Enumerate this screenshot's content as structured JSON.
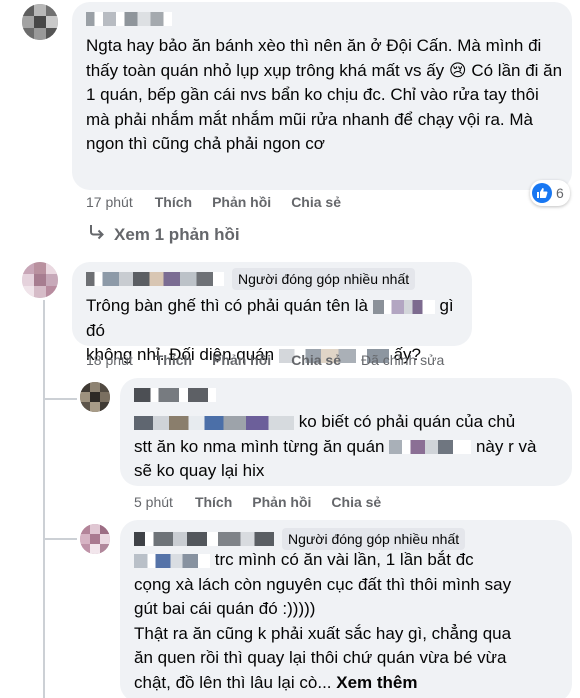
{
  "comments": [
    {
      "text": "Ngta hay bảo ăn bánh xèo thì nên ăn ở Đội Cấn. Mà mình đi thấy toàn quán nhỏ lụp xụp trông khá mất vs ấy 😢 Có lần đi ăn 1 quán, bếp gần cái nvs bẩn ko chịu đc. Chỉ vào rửa tay thôi mà phải nhắm mắt nhắm mũi rửa nhanh để chạy vội ra. Mà ngon thì cũng chả phải ngon cơ",
      "time": "17 phút",
      "like_label": "Thích",
      "reply_label": "Phản hồi",
      "share_label": "Chia sẻ",
      "reaction_count": "6",
      "reaction_icon": "like-icon",
      "view_replies_label": "Xem 1 phản hồi"
    },
    {
      "badge": "Người đóng góp nhiều nhất",
      "text_part1": "Trông bàn ghế thì có phải quán tên là",
      "text_part2": "gì đó",
      "text_part3": "không nhỉ. Đối diện quán",
      "text_part4": "ấy?",
      "time": "18 phút",
      "like_label": "Thích",
      "reply_label": "Phản hồi",
      "share_label": "Chia sẻ",
      "edited_label": "Đã chỉnh sửa"
    }
  ],
  "replies": [
    {
      "text_part1": "ko biết có phải quán của chủ",
      "text_part2": "stt ăn ko nma mình từng ăn quán",
      "text_part3": "này r và",
      "text_part4": "sẽ ko quay lại hix",
      "time": "5 phút",
      "like_label": "Thích",
      "reply_label": "Phản hồi",
      "share_label": "Chia sẻ"
    },
    {
      "badge": "Người đóng góp nhiều nhất",
      "text_part1": "trc mình có ăn vài lần, 1 lần bắt đc",
      "text_part2": "cọng xà lách còn nguyên cục đất thì thôi mình say",
      "text_part3": "gút bai cái quán đó :)))))",
      "text_part4": "Thật ra ăn cũng k phải xuất sắc hay gì, chẳng qua",
      "text_part5": "ăn quen rồi thì quay lại thôi chứ quán vừa bé vừa",
      "text_part6": "chật, đồ lên thì lâu lại cò...",
      "see_more": "Xem thêm"
    }
  ],
  "colors": {
    "bubble": "#f0f2f5",
    "meta": "#65676b",
    "like_blue": "#1877f2",
    "badge_bg": "#e4e6eb"
  }
}
